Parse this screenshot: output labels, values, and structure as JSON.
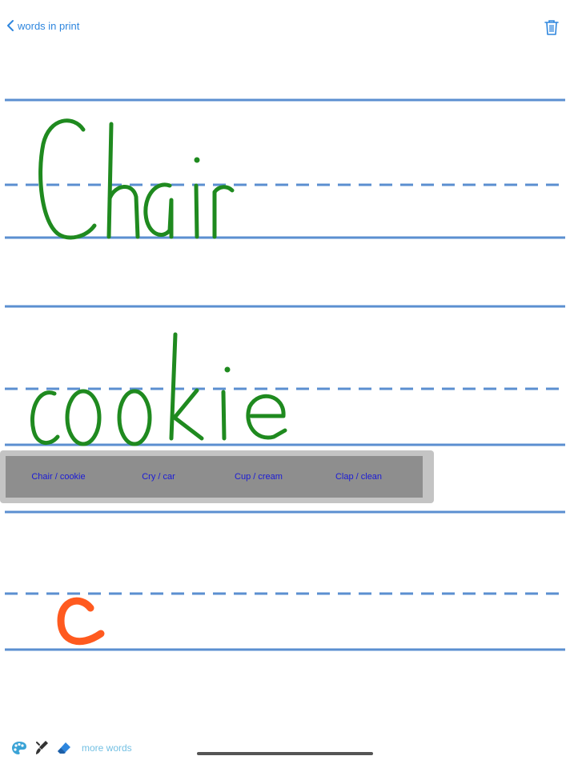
{
  "nav": {
    "back_label": "words in print",
    "back_icon": "chevron-left-icon",
    "trash_icon": "trash-icon",
    "accent_color": "#2e86de"
  },
  "handwriting": {
    "line1_text": "Chair",
    "line2_text": "cookie",
    "line3_text": "c",
    "line1_color": "#1f8a1f",
    "line2_color": "#1f8a1f",
    "line3_color": "#ff5a1f"
  },
  "word_options": [
    "Chair / cookie",
    "Cry / car",
    "Cup / cream",
    "Clap / clean"
  ],
  "toolbar": {
    "palette_icon": "palette-icon",
    "brush_icon": "brush-icon",
    "eraser_icon": "eraser-icon",
    "more_words_label": "more words"
  },
  "colors": {
    "line_color": "#5b8fd0",
    "popup_outer": "#c4c4c4",
    "popup_inner": "#8e8e8e",
    "option_text": "#1b1bd6",
    "more_words": "#74c0e3"
  }
}
